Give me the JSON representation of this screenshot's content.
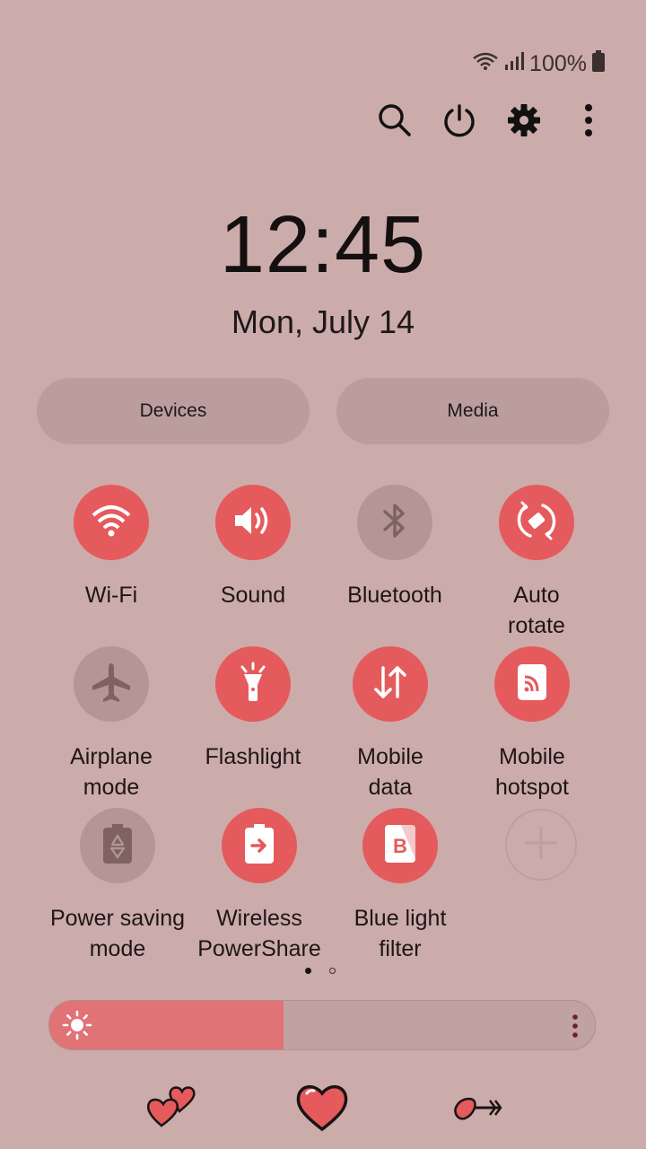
{
  "status": {
    "battery_text": "100%",
    "wifi_icon": "wifi-icon",
    "signal_icon": "signal-icon",
    "battery_icon": "battery-icon"
  },
  "toolbar": {
    "icons": [
      "search-icon",
      "power-icon",
      "gear-icon",
      "more-icon"
    ]
  },
  "clock": {
    "time": "12:45",
    "date": "Mon, July 14"
  },
  "buttons": {
    "devices": "Devices",
    "media": "Media"
  },
  "tiles": [
    {
      "label": "Wi-Fi",
      "state": "on",
      "icon": "wifi-icon"
    },
    {
      "label": "Sound",
      "state": "on",
      "icon": "sound-icon"
    },
    {
      "label": "Bluetooth",
      "state": "off",
      "icon": "bluetooth-icon"
    },
    {
      "label": "Auto\nrotate",
      "state": "on",
      "icon": "rotate-icon"
    },
    {
      "label": "Airplane\nmode",
      "state": "off",
      "icon": "airplane-icon"
    },
    {
      "label": "Flashlight",
      "state": "on",
      "icon": "flashlight-icon"
    },
    {
      "label": "Mobile\ndata",
      "state": "on",
      "icon": "mobile-data-icon"
    },
    {
      "label": "Mobile\nhotspot",
      "state": "on",
      "icon": "hotspot-icon"
    },
    {
      "label": "Power saving\nmode",
      "state": "off",
      "icon": "battery-recycle-icon"
    },
    {
      "label": "Wireless\nPowerShare",
      "state": "on",
      "icon": "powershare-icon"
    },
    {
      "label": "Blue light\nfilter",
      "state": "on",
      "icon": "blue-light-icon"
    }
  ],
  "page_indicator": {
    "current": 1,
    "total": 2
  },
  "brightness": {
    "level": 0.43,
    "icon": "sun-icon"
  },
  "colors": {
    "accent": "#e55a5c",
    "background": "#ccabab",
    "tile_off": "#b59595"
  },
  "decorations": [
    "double-heart-icon",
    "heart-icon",
    "heart-arrow-icon"
  ]
}
